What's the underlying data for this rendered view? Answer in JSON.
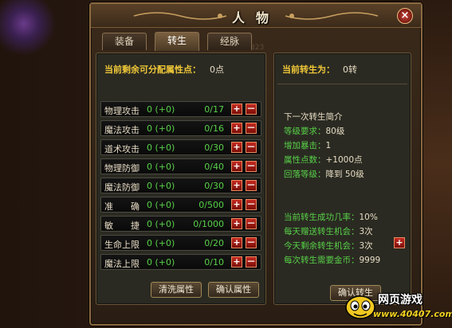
{
  "window": {
    "title": "人物",
    "close": "×"
  },
  "tabs": [
    "装备",
    "转生",
    "经脉"
  ],
  "watermark_num": "323",
  "attributes": {
    "remaining_label": "当前剩余可分配属性点：",
    "remaining_value": "0点",
    "rows": [
      {
        "name": "物理攻击",
        "value": "0 (+0)",
        "cap": "0/17"
      },
      {
        "name": "魔法攻击",
        "value": "0 (+0)",
        "cap": "0/16"
      },
      {
        "name": "道术攻击",
        "value": "0 (+0)",
        "cap": "0/30"
      },
      {
        "name": "物理防御",
        "value": "0 (+0)",
        "cap": "0/40"
      },
      {
        "name": "魔法防御",
        "value": "0 (+0)",
        "cap": "0/30"
      },
      {
        "name": "准　　确",
        "value": "0 (+0)",
        "cap": "0/500"
      },
      {
        "name": "敏　　捷",
        "value": "0 (+0)",
        "cap": "0/1000"
      },
      {
        "name": "生命上限",
        "value": "0 (+0)",
        "cap": "0/20"
      },
      {
        "name": "魔法上限",
        "value": "0 (+0)",
        "cap": "0/10"
      }
    ],
    "plus": "+",
    "minus": "－",
    "reset_label": "清洗属性",
    "confirm_label": "确认属性"
  },
  "rebirth": {
    "current_label": "当前转生为：",
    "current_value": "0转",
    "next_intro": "下一次转生简介",
    "level_req_label": "等级要求：",
    "level_req_value": "80级",
    "crit_label": "增加暴击：",
    "crit_value": "1",
    "attr_pts_label": "属性点数：",
    "attr_pts_value": "+1000点",
    "fallback_label": "回落等级：",
    "fallback_value": "降到 50级",
    "success_label": "当前转生成功几率：",
    "success_value": "10%",
    "daily_gift_label": "每天赠送转生机会：",
    "daily_gift_value": "3次",
    "today_left_label": "今天剩余转生机会：",
    "today_left_value": "3次",
    "gold_label": "每次转生需要金币：",
    "gold_value": "9999",
    "plus": "+",
    "confirm_label": "确认转生"
  },
  "logo": {
    "line1": "网页游戏",
    "line2": "www.40407.com"
  },
  "colors": {
    "gold_heading": "#f0c838",
    "green_value": "#58d048",
    "red_button": "#c42a20",
    "frame": "#8a6a40"
  }
}
